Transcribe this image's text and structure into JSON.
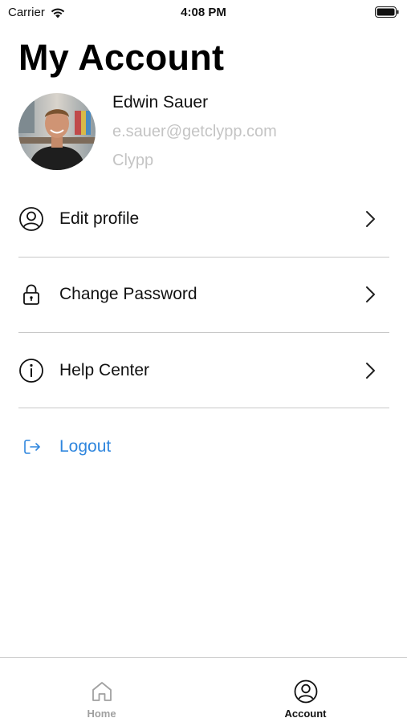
{
  "status_bar": {
    "carrier": "Carrier",
    "time": "4:08 PM"
  },
  "page": {
    "title": "My Account"
  },
  "profile": {
    "name": "Edwin Sauer",
    "email": "e.sauer@getclypp.com",
    "company": "Clypp"
  },
  "menu": {
    "items": [
      {
        "label": "Edit profile",
        "icon": "user-circle-icon"
      },
      {
        "label": "Change Password",
        "icon": "lock-icon"
      },
      {
        "label": "Help Center",
        "icon": "info-circle-icon"
      }
    ],
    "logout_label": "Logout"
  },
  "tab_bar": {
    "tabs": [
      {
        "label": "Home",
        "icon": "home-icon",
        "active": false
      },
      {
        "label": "Account",
        "icon": "user-circle-icon",
        "active": true
      }
    ]
  },
  "colors": {
    "accent": "#2f86de",
    "secondary_text": "#c4c4c4",
    "inactive_tab": "#a0a0a0",
    "divider": "#c8c8c8"
  }
}
